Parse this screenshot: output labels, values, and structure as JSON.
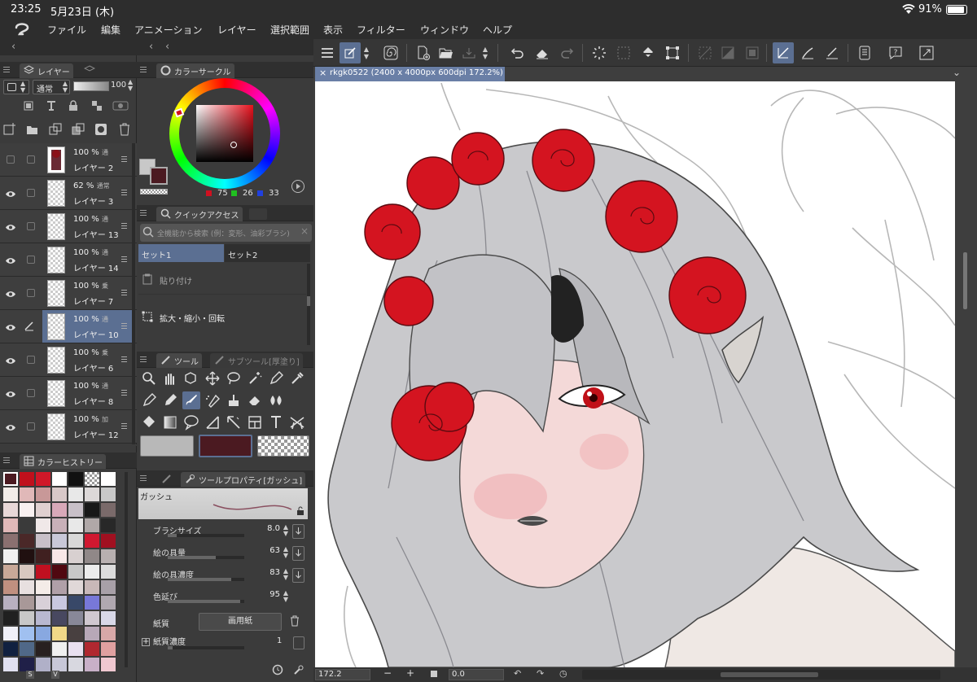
{
  "status": {
    "time": "23:25",
    "date": "5月23日 (木)",
    "battery": "91%"
  },
  "menu": {
    "items": [
      "ファイル",
      "編集",
      "アニメーション",
      "レイヤー",
      "選択範囲",
      "表示",
      "フィルター",
      "ウィンドウ",
      "ヘルプ"
    ]
  },
  "document": {
    "tab_title": "rkgk0522 (2400 x 4000px 600dpi 172.2%)"
  },
  "layers_panel": {
    "tab_label": "レイヤー",
    "blend_mode": "通常",
    "opacity": "100",
    "layers": [
      {
        "opacity": "100 %",
        "mode": "通",
        "name": "レイヤー 2",
        "visible": false,
        "selected": false
      },
      {
        "opacity": "62 %",
        "mode": "通常",
        "name": "レイヤー 3",
        "visible": true,
        "selected": false
      },
      {
        "opacity": "100 %",
        "mode": "通",
        "name": "レイヤー 13",
        "visible": true,
        "selected": false
      },
      {
        "opacity": "100 %",
        "mode": "通",
        "name": "レイヤー 14",
        "visible": true,
        "selected": false
      },
      {
        "opacity": "100 %",
        "mode": "乗",
        "name": "レイヤー 7",
        "visible": true,
        "selected": false
      },
      {
        "opacity": "100 %",
        "mode": "通",
        "name": "レイヤー 10",
        "visible": true,
        "selected": true
      },
      {
        "opacity": "100 %",
        "mode": "乗",
        "name": "レイヤー 6",
        "visible": true,
        "selected": false
      },
      {
        "opacity": "100 %",
        "mode": "通",
        "name": "レイヤー 8",
        "visible": true,
        "selected": false
      },
      {
        "opacity": "100 %",
        "mode": "加",
        "name": "レイヤー 12",
        "visible": true,
        "selected": false
      }
    ]
  },
  "color_circle": {
    "tab_label": "カラーサークル",
    "r": "75",
    "g": "26",
    "b": "33",
    "main_color": "#4b1a21",
    "sub_color": "#c8c8c8"
  },
  "quick_access": {
    "tab_label": "クイックアクセス",
    "search_placeholder": "全機能から検索 (例：変形、油彩ブラシ)",
    "sets": [
      "セット1",
      "セット2"
    ],
    "items": [
      "貼り付け",
      "拡大・縮小・回転"
    ]
  },
  "tools": {
    "tab_label": "ツール",
    "subtool_tab": "サブツール[厚塗り]",
    "swatch1": "#b8b8b8",
    "swatch2": "#4b1a21"
  },
  "color_history": {
    "tab_label": "カラーヒストリー",
    "colors": [
      "#4b1a21",
      "#c0101c",
      "#d01828",
      "#ffffff",
      "#111111",
      "#cccccc",
      "#ffffff",
      "#f2ece8",
      "#e0b8b8",
      "#c89898",
      "#d8c8c8",
      "#e8e8e8",
      "#dcd8d8",
      "#c8c8c8",
      "#e8d8d8",
      "#f8f0f0",
      "#e0d0d0",
      "#d8a8b8",
      "#c8c0c8",
      "#181818",
      "#7a6a6a",
      "#e0b8b8",
      "#3a3a3a",
      "#f0e8e8",
      "#c8b0b8",
      "#e8e8e8",
      "#b0a8a8",
      "#282828",
      "#8a7070",
      "#4a2828",
      "#c8c0c8",
      "#c8c8d8",
      "#d8d8d8",
      "#d01830",
      "#a01020",
      "#f0f0f0",
      "#201010",
      "#402020",
      "#f8e8e8",
      "#d8d0d0",
      "#908888",
      "#b8b0b0",
      "#c8a898",
      "#d8c8c0",
      "#c01020",
      "#500810",
      "#c8c8c8",
      "#ececec",
      "#dcdcdc",
      "#c09080",
      "#e8e0e0",
      "#f4ece8",
      "#b0a0a8",
      "#e0d8d8",
      "#c8b8b8",
      "#a8a0a8",
      "#b8b0c0",
      "#a89898",
      "#d8d0d8",
      "#c8c8e0",
      "#384868",
      "#7878d8",
      "#b0a8b0",
      "#202020",
      "#c8c8c8",
      "#b8b8d0",
      "#484860",
      "#888898",
      "#d0c8d0",
      "#d8d8e8",
      "#f0f0f8",
      "#a0c0f0",
      "#88a8e0",
      "#f0d888",
      "#484040",
      "#b8a8b8",
      "#d8a8a8",
      "#102040",
      "#506888",
      "#282020",
      "#f0f0f0",
      "#e8e0f0",
      "#b02830",
      "#e0a0a0",
      "#e0e0f0",
      "#202048",
      "#b0b0c8",
      "#c8c8d8",
      "#d8d8e0",
      "#c8b0c8",
      "#f0c8d0"
    ]
  },
  "tool_property": {
    "tab_label": "ツールプロパティ[ガッシュ]",
    "brush_name": "ガッシュ",
    "rows": [
      {
        "label": "ブラシサイズ",
        "value": "8.0",
        "fraction": 0.12
      },
      {
        "label": "絵の具量",
        "value": "63",
        "fraction": 0.63
      },
      {
        "label": "絵の具濃度",
        "value": "83",
        "fraction": 0.83
      },
      {
        "label": "色延び",
        "value": "95",
        "fraction": 0.95
      }
    ],
    "paper_label": "紙質",
    "paper_value": "画用紙",
    "paper_density_label": "紙質濃度",
    "paper_density_value": "1"
  },
  "bottom": {
    "zoom": "172.2",
    "angle": "0.0"
  },
  "colors": {
    "panel_bg": "#3b3b3b",
    "header_bg": "#2f2f2f",
    "accent": "#5b6f92",
    "canvas_bg": "#ffffff"
  }
}
